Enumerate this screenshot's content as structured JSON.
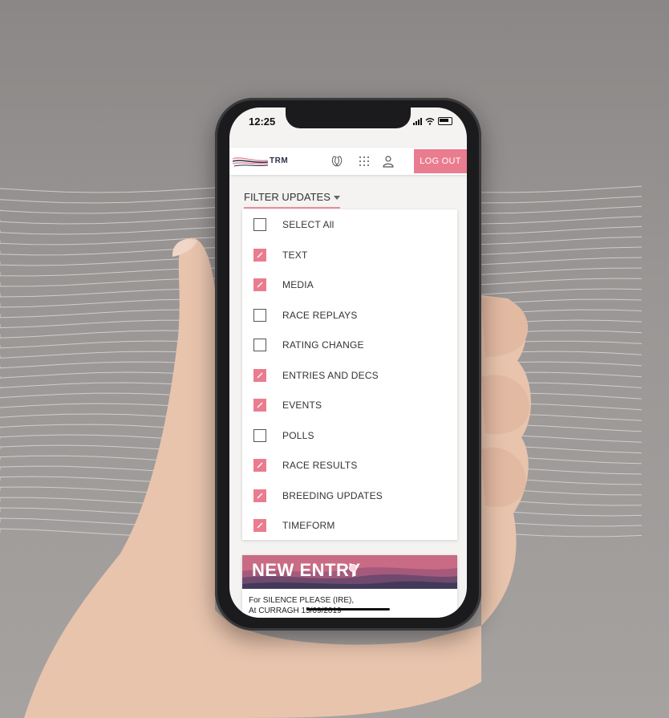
{
  "status_bar": {
    "time": "12:25"
  },
  "header": {
    "logo_text": "TRM",
    "logout_label": "LOG OUT",
    "icons": [
      "horseshoe-icon",
      "grid-icon",
      "user-icon"
    ]
  },
  "filter": {
    "toggle_label": "FILTER UPDATES",
    "items": [
      {
        "label": "SELECT All",
        "checked": false
      },
      {
        "label": "TEXT",
        "checked": true
      },
      {
        "label": "MEDIA",
        "checked": true
      },
      {
        "label": "RACE REPLAYS",
        "checked": false
      },
      {
        "label": "RATING CHANGE",
        "checked": false
      },
      {
        "label": "ENTRIES AND DECS",
        "checked": true
      },
      {
        "label": "EVENTS",
        "checked": true
      },
      {
        "label": "POLLS",
        "checked": false
      },
      {
        "label": "RACE RESULTS",
        "checked": true
      },
      {
        "label": "BREEDING UPDATES",
        "checked": true
      },
      {
        "label": "TIMEFORM",
        "checked": true
      }
    ]
  },
  "entry": {
    "title": "NEW ENTRY",
    "line1": "For SILENCE PLEASE (IRE),",
    "line2": "At CURRAGH 15/09/2019"
  },
  "colors": {
    "accent": "#ea7c8f",
    "brand_dark": "#2b2f4a"
  }
}
